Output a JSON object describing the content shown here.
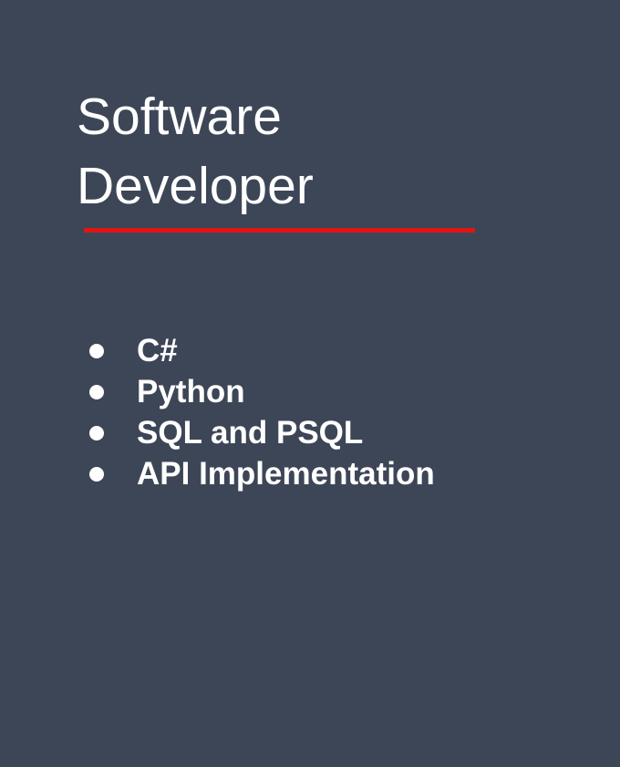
{
  "slide": {
    "title_line1": "Software",
    "title_line2": "Developer",
    "accent_color": "#e01515",
    "bullets": [
      "C#",
      "Python",
      "SQL and PSQL",
      "API Implementation"
    ]
  }
}
